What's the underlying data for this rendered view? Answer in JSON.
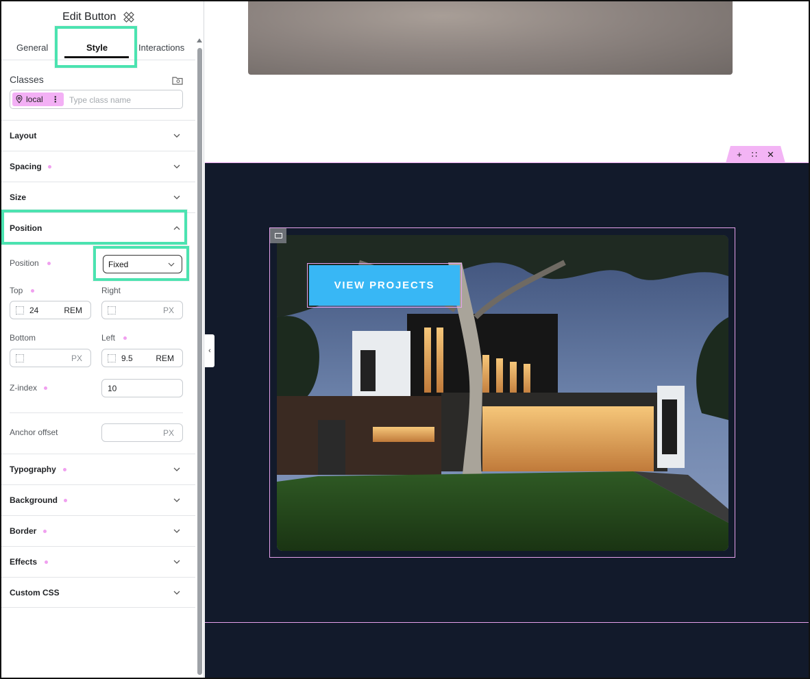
{
  "panel": {
    "title": "Edit Button",
    "tabs": [
      "General",
      "Style",
      "Interactions"
    ],
    "active_tab": "Style",
    "classes": {
      "label": "Classes",
      "chip_label": "local",
      "placeholder": "Type class name"
    },
    "sections": {
      "layout": "Layout",
      "spacing": "Spacing",
      "size": "Size",
      "position": "Position",
      "typography": "Typography",
      "background": "Background",
      "border": "Border",
      "effects": "Effects",
      "custom_css": "Custom CSS"
    },
    "position": {
      "position_label": "Position",
      "position_value": "Fixed",
      "top_label": "Top",
      "top_value": "24",
      "top_unit": "REM",
      "right_label": "Right",
      "right_value": "",
      "right_unit": "PX",
      "bottom_label": "Bottom",
      "bottom_value": "",
      "bottom_unit": "PX",
      "left_label": "Left",
      "left_value": "9.5",
      "left_unit": "REM",
      "zindex_label": "Z-index",
      "zindex_value": "10",
      "anchor_label": "Anchor offset",
      "anchor_value": "",
      "anchor_unit": "PX"
    }
  },
  "canvas": {
    "section_toolbar": {
      "add": "+",
      "move": "∷",
      "close": "✕"
    },
    "collapse_icon": "‹",
    "cta_label": "VIEW PROJECTS"
  },
  "colors": {
    "accent_highlight": "#4be3b0",
    "selection_pink": "#e7a2ee",
    "dark_section_bg": "#121a2b",
    "cta_bg": "#38b7f5"
  }
}
